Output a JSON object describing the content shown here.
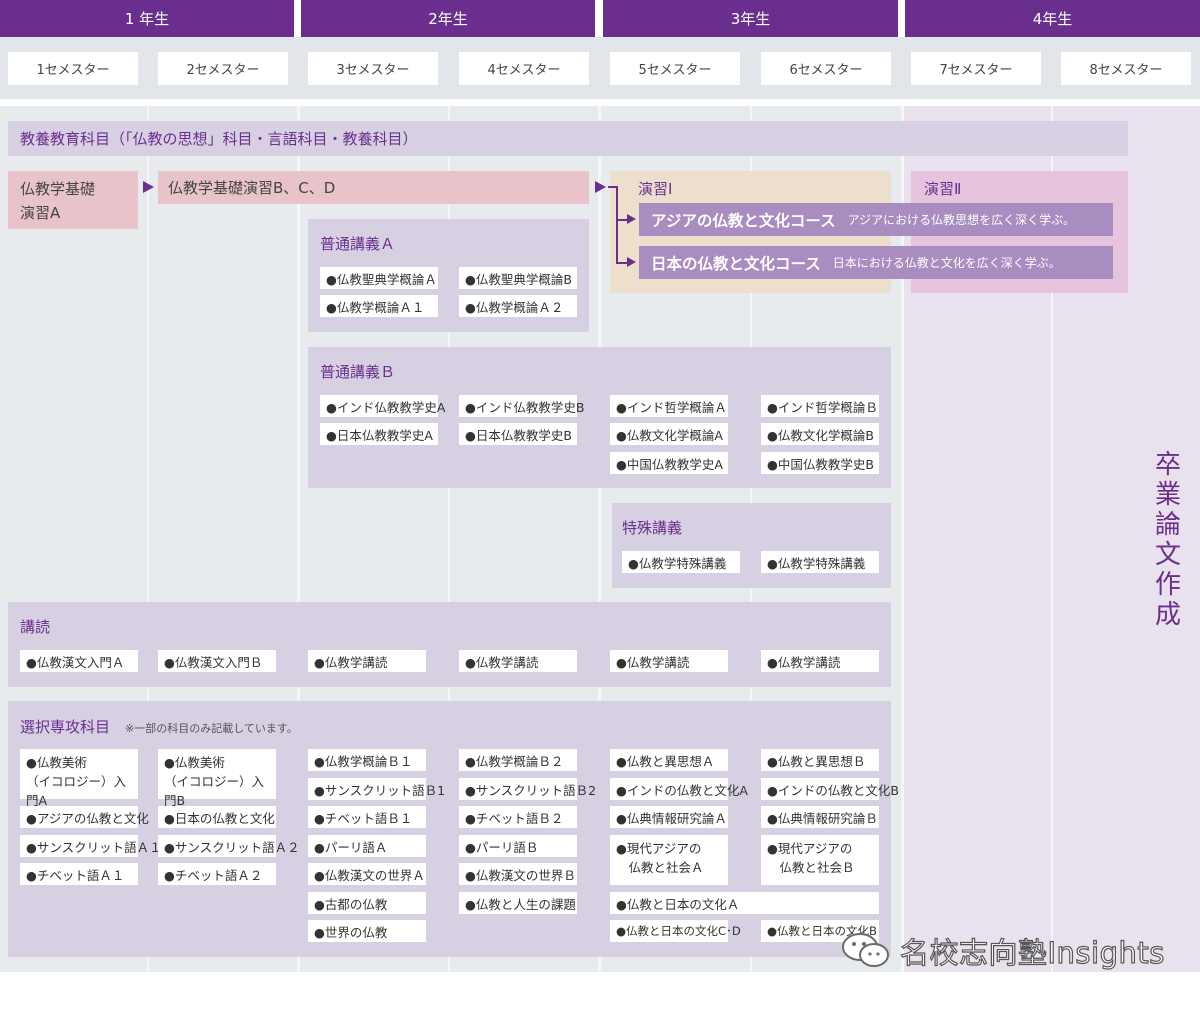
{
  "years": [
    "1 年生",
    "2年生",
    "3年生",
    "4年生"
  ],
  "semesters": [
    "1セメスター",
    "2セメスター",
    "3セメスター",
    "4セメスター",
    "5セメスター",
    "6セメスター",
    "7セメスター",
    "8セメスター"
  ],
  "liberal_arts": "教養教育科目（「仏教の思想」科目・言語科目・教養科目）",
  "foundation_a": "仏教学基礎\n演習A",
  "foundation_bcd": "仏教学基礎演習B、C、D",
  "seminar1": "演習Ⅰ",
  "seminar2": "演習Ⅱ",
  "courses": [
    {
      "name": "アジアの仏教と文化コース",
      "desc": "アジアにおける仏教思想を広く深く学ぶ。"
    },
    {
      "name": "日本の仏教と文化コース",
      "desc": "日本における仏教と文化を広く深く学ぶ。"
    }
  ],
  "general_a": {
    "title": "普通講義Ａ",
    "items": [
      "●仏教聖典学概論Ａ",
      "●仏教聖典学概論B",
      "●仏教学概論Ａ１",
      "●仏教学概論Ａ２"
    ]
  },
  "general_b": {
    "title": "普通講義Ｂ",
    "items": [
      "●インド仏教教学史A",
      "●インド仏教教学史B",
      "●インド哲学概論Ａ",
      "●インド哲学概論Ｂ",
      "●日本仏教教学史A",
      "●日本仏教教学史B",
      "●仏教文化学概論A",
      "●仏教文化学概論B",
      "●中国仏教教学史A",
      "●中国仏教教学史B"
    ]
  },
  "special": {
    "title": "特殊講義",
    "items": [
      "●仏教学特殊講義",
      "●仏教学特殊講義"
    ]
  },
  "reading": {
    "title": "講読",
    "items": [
      "●仏教漢文入門Ａ",
      "●仏教漢文入門Ｂ",
      "●仏教学講読",
      "●仏教学講読",
      "●仏教学講読",
      "●仏教学講読"
    ]
  },
  "elective": {
    "title": "選択専攻科目",
    "note": "※一部の科目のみ記載しています。",
    "c1": [
      "●仏教美術\n（イコロジー）入門A",
      "●アジアの仏教と文化",
      "●サンスクリット語Ａ１",
      "●チベット語Ａ１"
    ],
    "c2": [
      "●仏教美術\n（イコロジー）入門B",
      "●日本の仏教と文化",
      "●サンスクリット語Ａ２",
      "●チベット語Ａ２"
    ],
    "c3": [
      "●仏教学概論Ｂ１",
      "●サンスクリット語Ｂ1",
      "●チベット語Ｂ１",
      "●パーリ語Ａ",
      "●仏教漢文の世界Ａ",
      "●古都の仏教",
      "●世界の仏教"
    ],
    "c4": [
      "●仏教学概論Ｂ２",
      "●サンスクリット語Ｂ2",
      "●チベット語Ｂ２",
      "●パーリ語Ｂ",
      "●仏教漢文の世界Ｂ",
      "●仏教と人生の課題"
    ],
    "c5": [
      "●仏教と異思想Ａ",
      "●インドの仏教と文化A",
      "●仏典情報研究論Ａ",
      "●現代アジアの\n　仏教と社会Ａ"
    ],
    "c6": [
      "●仏教と異思想Ｂ",
      "●インドの仏教と文化B",
      "●仏典情報研究論Ｂ",
      "●現代アジアの\n　仏教と社会Ｂ"
    ],
    "wide": "●仏教と日本の文化Ａ",
    "cd": "●仏教と日本の文化C･D",
    "last": "●仏教と日本の文化B"
  },
  "thesis": "卒業論文作成",
  "watermark": "名校志向塾Insights",
  "colors": {
    "accent": "#6a2f8e",
    "band": "#d7d0e2",
    "pink": "#e8c3c9",
    "beige": "#ece0cc",
    "course": "#a98cc0"
  }
}
